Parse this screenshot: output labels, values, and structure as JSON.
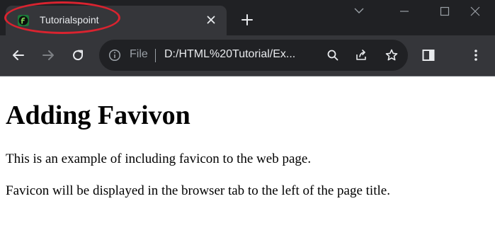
{
  "browser": {
    "tab": {
      "title": "Tutorialspoint"
    },
    "address_bar": {
      "scheme_label": "File",
      "url": "D:/HTML%20Tutorial/Ex..."
    }
  },
  "page": {
    "heading": "Adding Favivon",
    "paragraphs": [
      "This is an example of including favicon to the web page.",
      "Favicon will be displayed in the browser tab to the left of the page title."
    ]
  },
  "colors": {
    "annotation_circle": "#d9232f",
    "favicon_green": "#1b7b39"
  },
  "icons": {
    "favicon": "tutorialspoint-favicon-icon",
    "tab_close": "close-icon",
    "new_tab": "plus-icon",
    "tab_search": "chevron-down-icon",
    "minimize": "minimize-icon",
    "maximize": "maximize-icon",
    "close_window": "close-icon",
    "back": "back-arrow-icon",
    "forward": "forward-arrow-icon",
    "reload": "reload-icon",
    "site_info": "info-icon",
    "zoom": "search-icon",
    "share": "share-icon",
    "bookmark": "star-icon",
    "side_panel": "side-panel-icon",
    "menu": "kebab-menu-icon"
  }
}
